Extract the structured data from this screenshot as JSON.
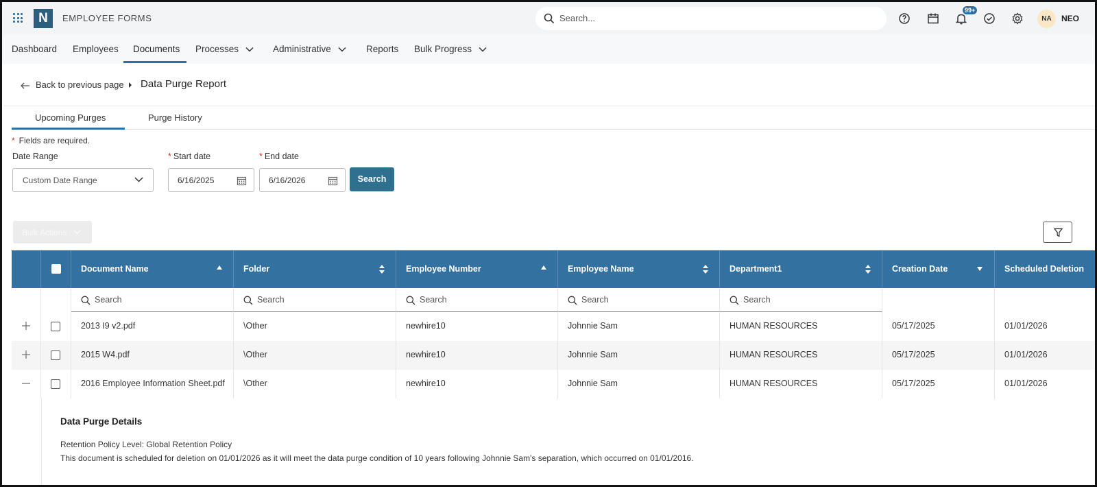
{
  "app": {
    "logo_letter": "N",
    "title": "EMPLOYEE FORMS"
  },
  "topbar": {
    "search_placeholder": "Search...",
    "notifications_badge": "99+",
    "avatar_initials": "NA",
    "user_short": "NEO"
  },
  "nav": {
    "items": [
      {
        "label": "Dashboard"
      },
      {
        "label": "Employees"
      },
      {
        "label": "Documents"
      },
      {
        "label": "Processes"
      },
      {
        "label": "Administrative"
      },
      {
        "label": "Reports"
      },
      {
        "label": "Bulk Progress"
      }
    ],
    "active": "Documents"
  },
  "breadcrumb": {
    "back_label": "Back to previous page",
    "current": "Data Purge Report"
  },
  "tabs": [
    {
      "label": "Upcoming Purges"
    },
    {
      "label": "Purge History"
    }
  ],
  "form": {
    "required_note": "Fields are required.",
    "date_range_label": "Date Range",
    "date_range_value": "Custom Date Range",
    "start_label": "Start date",
    "start_value": "6/16/2025",
    "end_label": "End date",
    "end_value": "6/16/2026",
    "search_button": "Search"
  },
  "toolbar": {
    "bulk_actions": "Bulk Actions"
  },
  "table": {
    "columns": [
      "Document Name",
      "Folder",
      "Employee Number",
      "Employee Name",
      "Department1",
      "Creation Date",
      "Scheduled Deletion"
    ],
    "filter_placeholder": "Search",
    "rows": [
      {
        "doc": "2013 I9 v2.pdf",
        "folder": "\\Other",
        "emp_no": "newhire10",
        "emp_name": "Johnnie Sam",
        "dept": "HUMAN RESOURCES",
        "created": "05/17/2025",
        "scheduled": "01/01/2026"
      },
      {
        "doc": "2015 W4.pdf",
        "folder": "\\Other",
        "emp_no": "newhire10",
        "emp_name": "Johnnie Sam",
        "dept": "HUMAN RESOURCES",
        "created": "05/17/2025",
        "scheduled": "01/01/2026"
      },
      {
        "doc": "2016 Employee Information Sheet.pdf",
        "folder": "\\Other",
        "emp_no": "newhire10",
        "emp_name": "Johnnie Sam",
        "dept": "HUMAN RESOURCES",
        "created": "05/17/2025",
        "scheduled": "01/01/2026"
      }
    ]
  },
  "details": {
    "title": "Data Purge Details",
    "policy": "Retention Policy Level: Global Retention Policy",
    "message": "This document is scheduled for deletion on 01/01/2026 as it will meet the data purge condition of 10 years following Johnnie Sam's separation, which occurred on 01/01/2016."
  },
  "colors": {
    "primary": "#3371a0",
    "button": "#2f6f8f",
    "required": "#c0392b"
  }
}
